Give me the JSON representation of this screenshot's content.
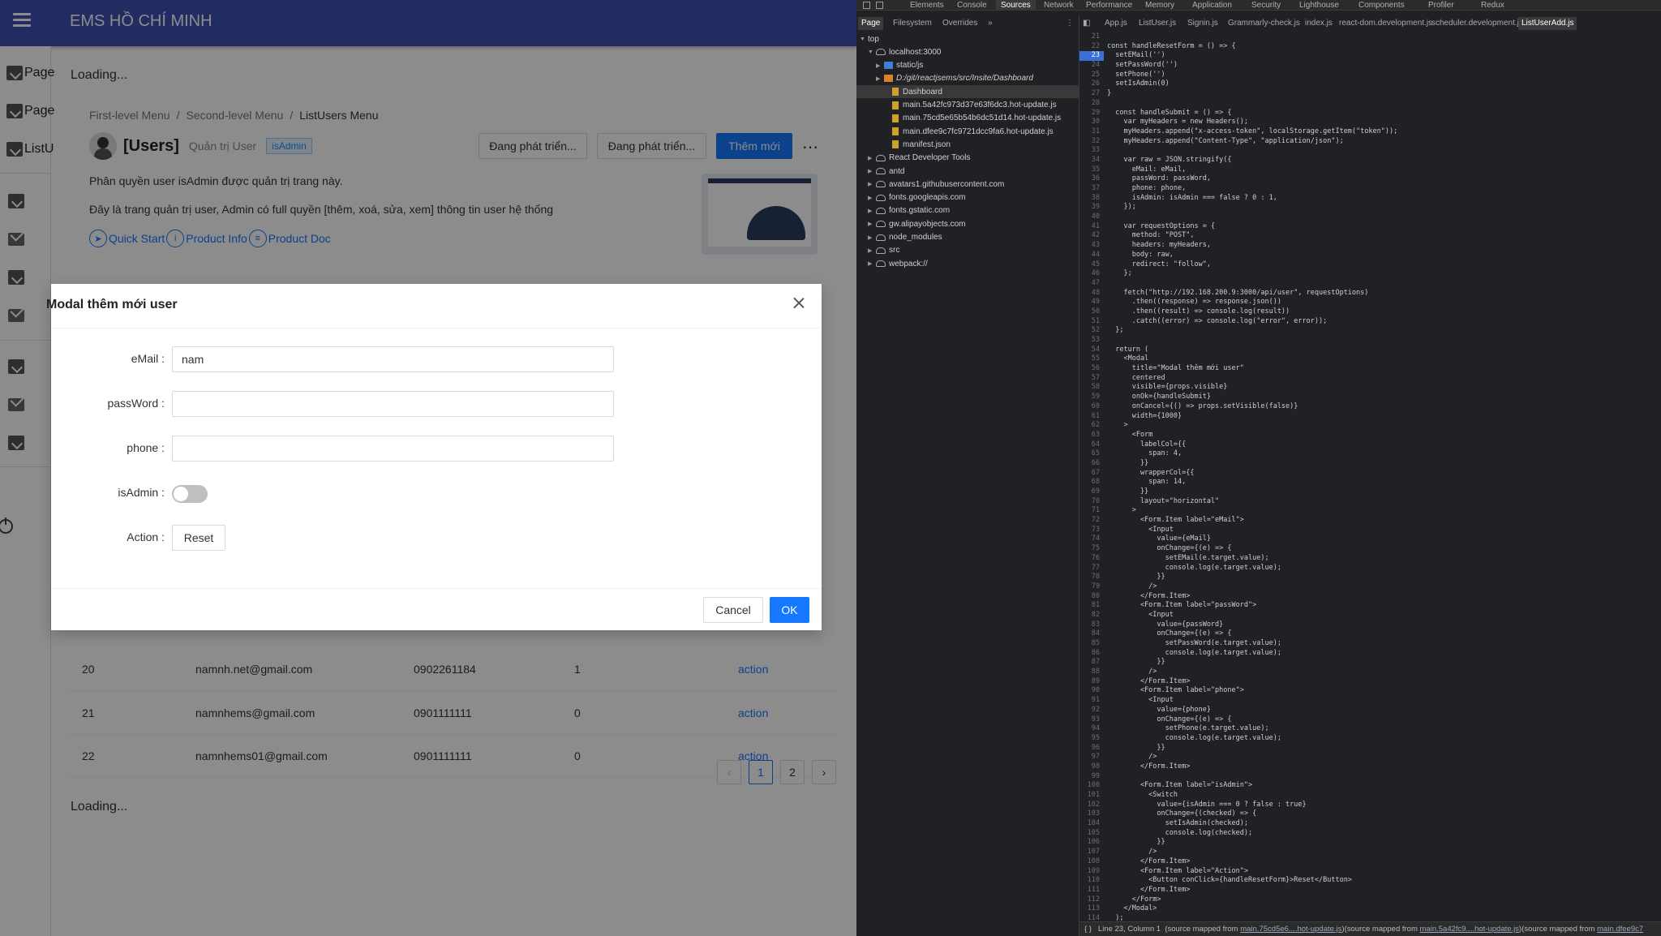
{
  "app": {
    "title": "EMS HỒ CHÍ MINH",
    "drawer_items": [
      "Page",
      "Page",
      "ListU"
    ],
    "loading_text": "Loading...",
    "breadcrumb": [
      "First-level Menu",
      "Second-level Menu",
      "ListUsers Menu"
    ],
    "header": {
      "title": "[Users]",
      "subtitle": "Quản trị User",
      "tag": "isAdmin",
      "buttons": [
        "Đang phát triển...",
        "Đang phát triển...",
        "Thêm mới"
      ]
    },
    "description": [
      "Phân quyền user isAdmin được quản trị trang này.",
      "Đây là trang quản trị user, Admin có full quyền [thêm, xoá, sửa, xem] thông tin user hệ thống"
    ],
    "links": [
      "Quick Start",
      "Product Info",
      "Product Doc"
    ],
    "table_rows": [
      {
        "id": "20",
        "email": "namnh.net@gmail.com",
        "phone": "0902261184",
        "admin": "1",
        "action": "action"
      },
      {
        "id": "21",
        "email": "namnhems@gmail.com",
        "phone": "0901111111",
        "admin": "0",
        "action": "action"
      },
      {
        "id": "22",
        "email": "namnhems01@gmail.com",
        "phone": "0901111111",
        "admin": "0",
        "action": "action"
      }
    ],
    "pagination": {
      "pages": [
        "1",
        "2"
      ],
      "current": "1"
    },
    "modal": {
      "title": "Modal thêm mới user",
      "fields": {
        "email_label": "eMail",
        "email_value": "nam",
        "password_label": "passWord",
        "password_value": "",
        "phone_label": "phone",
        "phone_value": "",
        "isadmin_label": "isAdmin",
        "action_label": "Action",
        "reset_label": "Reset"
      },
      "isadmin_checked": false,
      "cancel_label": "Cancel",
      "ok_label": "OK"
    }
  },
  "devtools": {
    "top_tabs": [
      "Elements",
      "Console",
      "Sources",
      "Network",
      "Performance",
      "Memory",
      "Application",
      "Security",
      "Lighthouse",
      "Components",
      "Profiler",
      "Redux"
    ],
    "active_top_tab": "Sources",
    "nav_tabs": [
      "Page",
      "Filesystem",
      "Overrides"
    ],
    "tree": [
      {
        "label": "top",
        "indent": 0,
        "kind": "arrow-open"
      },
      {
        "label": "localhost:3000",
        "indent": 1,
        "kind": "cloud-open"
      },
      {
        "label": "static/js",
        "indent": 2,
        "kind": "folder-blue"
      },
      {
        "label": "D:/git/reactjsems/src/Insite/Dashboard",
        "indent": 2,
        "kind": "folder-orange"
      },
      {
        "label": "Dashboard",
        "indent": 3,
        "kind": "file-sel"
      },
      {
        "label": "main.5a42fc973d37e63f6dc3.hot-update.js",
        "indent": 3,
        "kind": "file"
      },
      {
        "label": "main.75cd5e65b54b6dc51d14.hot-update.js",
        "indent": 3,
        "kind": "file"
      },
      {
        "label": "main.dfee9c7fc9721dcc9fa6.hot-update.js",
        "indent": 3,
        "kind": "file"
      },
      {
        "label": "manifest.json",
        "indent": 3,
        "kind": "file"
      },
      {
        "label": "React Developer Tools",
        "indent": 1,
        "kind": "cloud"
      },
      {
        "label": "antd",
        "indent": 1,
        "kind": "cloud"
      },
      {
        "label": "avatars1.githubusercontent.com",
        "indent": 1,
        "kind": "cloud"
      },
      {
        "label": "fonts.googleapis.com",
        "indent": 1,
        "kind": "cloud"
      },
      {
        "label": "fonts.gstatic.com",
        "indent": 1,
        "kind": "cloud"
      },
      {
        "label": "gw.alipayobjects.com",
        "indent": 1,
        "kind": "cloud"
      },
      {
        "label": "node_modules",
        "indent": 1,
        "kind": "cloud"
      },
      {
        "label": "src",
        "indent": 1,
        "kind": "cloud"
      },
      {
        "label": "webpack://",
        "indent": 1,
        "kind": "cloud"
      }
    ],
    "file_tabs": [
      "App.js",
      "ListUser.js",
      "Signin.js",
      "Grammarly-check.js",
      "index.js",
      "react-dom.development.js",
      "scheduler.development.js",
      "ListUserAdd.js"
    ],
    "active_file_tab": "ListUserAdd.js",
    "first_line": 21,
    "highlight_line": 23,
    "code_lines": [
      "",
      "const handleResetForm = () => {",
      "  setEMail('')",
      "  setPassWord('')",
      "  setPhone('')",
      "  setIsAdmin(0)",
      "}",
      "",
      "  const handleSubmit = () => {",
      "    var myHeaders = new Headers();",
      "    myHeaders.append(\"x-access-token\", localStorage.getItem(\"token\"));",
      "    myHeaders.append(\"Content-Type\", \"application/json\");",
      "",
      "    var raw = JSON.stringify({",
      "      eMail: eMail,",
      "      passWord: passWord,",
      "      phone: phone,",
      "      isAdmin: isAdmin === false ? 0 : 1,",
      "    });",
      "",
      "    var requestOptions = {",
      "      method: \"POST\",",
      "      headers: myHeaders,",
      "      body: raw,",
      "      redirect: \"follow\",",
      "    };",
      "",
      "    fetch(\"http://192.168.200.9:3000/api/user\", requestOptions)",
      "      .then((response) => response.json())",
      "      .then((result) => console.log(result))",
      "      .catch((error) => console.log(\"error\", error));",
      "  };",
      "",
      "  return (",
      "    <Modal",
      "      title=\"Modal thêm mới user\"",
      "      centered",
      "      visible={props.visible}",
      "      onOk={handleSubmit}",
      "      onCancel={() => props.setVisible(false)}",
      "      width={1000}",
      "    >",
      "      <Form",
      "        labelCol={{",
      "          span: 4,",
      "        }}",
      "        wrapperCol={{",
      "          span: 14,",
      "        }}",
      "        layout=\"horizontal\"",
      "      >",
      "        <Form.Item label=\"eMail\">",
      "          <Input",
      "            value={eMail}",
      "            onChange={(e) => {",
      "              setEMail(e.target.value);",
      "              console.log(e.target.value);",
      "            }}",
      "          />",
      "        </Form.Item>",
      "        <Form.Item label=\"passWord\">",
      "          <Input",
      "            value={passWord}",
      "            onChange={(e) => {",
      "              setPassWord(e.target.value);",
      "              console.log(e.target.value);",
      "            }}",
      "          />",
      "        </Form.Item>",
      "        <Form.Item label=\"phone\">",
      "          <Input",
      "            value={phone}",
      "            onChange={(e) => {",
      "              setPhone(e.target.value);",
      "              console.log(e.target.value);",
      "            }}",
      "          />",
      "        </Form.Item>",
      "",
      "        <Form.Item label=\"isAdmin\">",
      "          <Switch",
      "            value={isAdmin === 0 ? false : true}",
      "            onChange={(checked) => {",
      "              setIsAdmin(checked);",
      "              console.log(checked);",
      "            }}",
      "          />",
      "        </Form.Item>",
      "        <Form.Item label=\"Action\">",
      "          <Button conClick={handleResetForm}>Reset</Button>",
      "        </Form.Item>",
      "      </Form>",
      "    </Modal>",
      "  );"
    ],
    "status": {
      "braces": "{ }",
      "position": "Line 23, Column 1",
      "source_prefix": "(source mapped from",
      "source1": "main.75cd5e6....hot-update.js",
      "source_mid": ")(source mapped from",
      "source2": "main.5a42fc9....hot-update.js",
      "source_mid2": ")(source mapped from",
      "source3": "main.dfee9c7"
    }
  }
}
